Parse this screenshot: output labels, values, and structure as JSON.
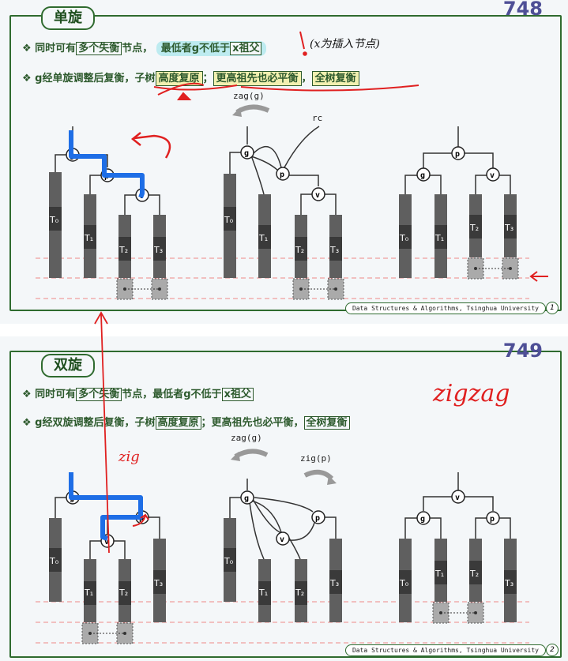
{
  "slide1": {
    "tag": "单旋",
    "page_number": "748",
    "bullet1": {
      "prefix": "❖ 同时可有",
      "box1": "多个失衡",
      "mid": "节点，",
      "hl": "最低者g不低于",
      "box2": "x祖父"
    },
    "bullet2": {
      "prefix": "❖ g经单旋调整后复衡，子树",
      "box1": "高度复原",
      "sep": "；",
      "box2": "更高祖先也必平衡",
      "comma": "，",
      "box3": "全树复衡"
    },
    "rotation_label": "zag(g)",
    "rc_label": "rc",
    "annotation": "(x为插入节点)",
    "footer": "Data Structures & Algorithms, Tsinghua University",
    "slide_index": "1"
  },
  "slide2": {
    "tag": "双旋",
    "page_number": "749",
    "bullet1": {
      "prefix": "❖ 同时可有",
      "box1": "多个失衡",
      "mid": "节点，最低者g不低于",
      "box2": "x祖父"
    },
    "bullet2": {
      "prefix": "❖ g经双旋调整后复衡，子树",
      "box1": "高度复原",
      "mid": "；更高祖先也必平衡，",
      "box2": "全树复衡"
    },
    "rotation_label1": "zag(g)",
    "rotation_label2": "zig(p)",
    "annotation_zigzag": "zigzag",
    "annotation_zig": "zig",
    "footer": "Data Structures & Algorithms, Tsinghua University",
    "slide_index": "2"
  },
  "nodes": {
    "g": "g",
    "p": "p",
    "v": "v"
  },
  "subtrees": {
    "t0": "T₀",
    "t1": "T₁",
    "t2": "T₂",
    "t3": "T₃"
  },
  "colors": {
    "frame": "#2f6b2f",
    "title_num": "#4e4f96",
    "ink_red": "#e02020",
    "ink_blue": "#1e6ee6",
    "subtree": "#5f5f5f"
  }
}
